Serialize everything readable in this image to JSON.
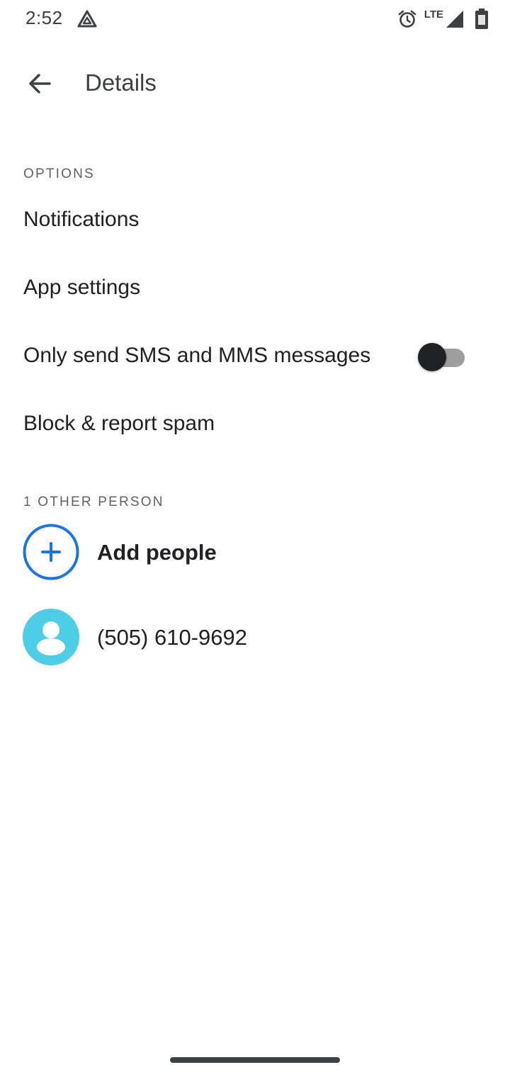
{
  "status_bar": {
    "time": "2:52",
    "network": "LTE",
    "icons": [
      "drive-icon",
      "alarm-icon",
      "signal-icon",
      "battery-icon"
    ]
  },
  "app_bar": {
    "back_icon": "arrow-back-icon",
    "title": "Details"
  },
  "options": {
    "header": "OPTIONS",
    "items": [
      {
        "label": "Notifications"
      },
      {
        "label": "App settings"
      },
      {
        "label": "Only send SMS and MMS messages",
        "toggle_on": false
      },
      {
        "label": "Block & report spam"
      }
    ]
  },
  "people": {
    "header": "1 OTHER PERSON",
    "add_label": "Add people",
    "contacts": [
      {
        "label": "(505) 610-9692"
      }
    ]
  },
  "colors": {
    "accent_blue": "#1a73e8",
    "avatar_bg": "#4ecde6",
    "text_primary": "#202124",
    "text_secondary": "#5f6368"
  }
}
